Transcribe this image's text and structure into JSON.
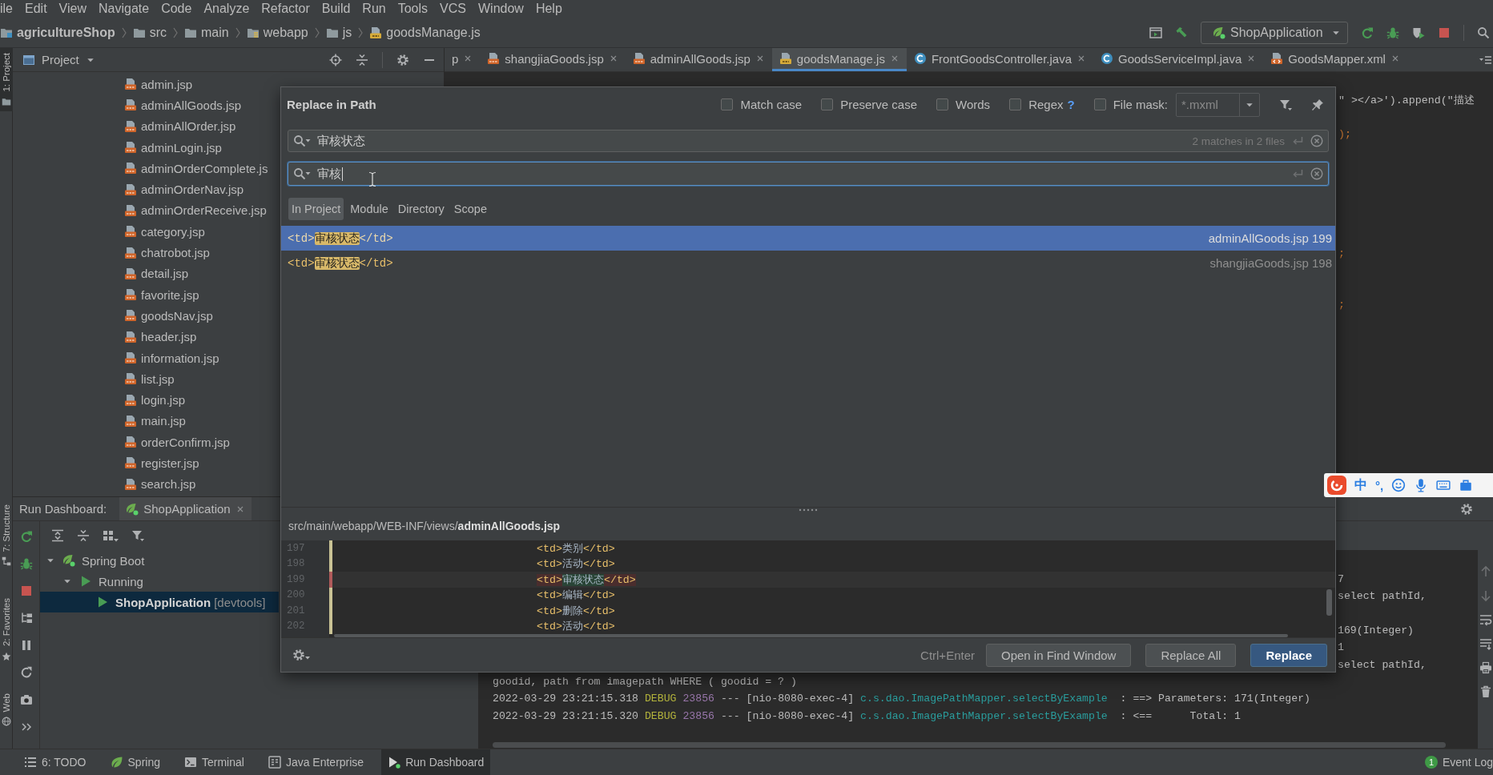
{
  "menu": [
    "ile",
    "Edit",
    "View",
    "Navigate",
    "Code",
    "Analyze",
    "Refactor",
    "Build",
    "Run",
    "Tools",
    "VCS",
    "Window",
    "Help"
  ],
  "navbar": {
    "breadcrumb": [
      {
        "label": "agricultureShop",
        "kind": "module"
      },
      {
        "label": "src",
        "kind": "folder"
      },
      {
        "label": "main",
        "kind": "folder"
      },
      {
        "label": "webapp",
        "kind": "web"
      },
      {
        "label": "js",
        "kind": "folder"
      },
      {
        "label": "goodsManage.js",
        "kind": "js"
      }
    ],
    "run_config": "ShopApplication"
  },
  "side_strip": [
    {
      "label": "1: Project",
      "kind": "project",
      "selected": true
    },
    {
      "label": "7: Structure",
      "kind": "structure",
      "selected": false
    },
    {
      "label": "2: Favorites",
      "kind": "favorites",
      "selected": false
    },
    {
      "label": "Web",
      "kind": "web",
      "selected": false
    }
  ],
  "project": {
    "title": "Project",
    "files": [
      "admin.jsp",
      "adminAllGoods.jsp",
      "adminAllOrder.jsp",
      "adminLogin.jsp",
      "adminOrderComplete.js",
      "adminOrderNav.jsp",
      "adminOrderReceive.jsp",
      "category.jsp",
      "chatrobot.jsp",
      "detail.jsp",
      "favorite.jsp",
      "goodsNav.jsp",
      "header.jsp",
      "information.jsp",
      "list.jsp",
      "login.jsp",
      "main.jsp",
      "orderConfirm.jsp",
      "register.jsp",
      "search.jsp"
    ]
  },
  "editor": {
    "tabs": [
      {
        "label": "p",
        "kind": "cut",
        "selected": false
      },
      {
        "label": "shangjiaGoods.jsp",
        "kind": "jsp",
        "selected": false
      },
      {
        "label": "adminAllGoods.jsp",
        "kind": "jsp",
        "selected": false
      },
      {
        "label": "goodsManage.js",
        "kind": "js",
        "selected": true
      },
      {
        "label": "FrontGoodsController.java",
        "kind": "class",
        "selected": false
      },
      {
        "label": "GoodsServiceImpl.java",
        "kind": "class",
        "selected": false
      },
      {
        "label": "GoodsMapper.xml",
        "kind": "xml",
        "selected": false
      }
    ],
    "lines": [
      {
        "kind": "plain",
        "text": "\" ></a>').append(\"描述"
      },
      {
        "kind": "blank"
      },
      {
        "kind": "keyword",
        "text": ");"
      },
      {
        "kind": "blank"
      },
      {
        "kind": "blank"
      },
      {
        "kind": "blank"
      },
      {
        "kind": "blank"
      },
      {
        "kind": "blank"
      },
      {
        "kind": "blank"
      },
      {
        "kind": "keyword",
        "text": ";"
      },
      {
        "kind": "blank"
      },
      {
        "kind": "blank"
      },
      {
        "kind": "keyword",
        "text": ";"
      }
    ]
  },
  "dialog": {
    "title": "Replace in Path",
    "options": [
      {
        "label": "Match case",
        "checked": false
      },
      {
        "label": "Preserve case",
        "checked": false
      },
      {
        "label": "Words",
        "checked": false
      },
      {
        "label": "Regex",
        "checked": false,
        "help": "?"
      },
      {
        "label": "File mask:",
        "checked": false
      }
    ],
    "file_mask": {
      "value": "*.mxml",
      "disabled": true
    },
    "search": {
      "value": "审核状态",
      "status": "2 matches in 2 files",
      "focused": false
    },
    "replace": {
      "value": "审核",
      "focused": true
    },
    "scopes": [
      {
        "label": "In Project",
        "selected": true
      },
      {
        "label": "Module",
        "selected": false
      },
      {
        "label": "Directory",
        "selected": false
      },
      {
        "label": "Scope",
        "selected": false
      }
    ],
    "results": [
      {
        "before": "<td>",
        "match": "审核状态",
        "after": "</td>",
        "location": "adminAllGoods.jsp 199",
        "selected": true
      },
      {
        "before": "<td>",
        "match": "审核状态",
        "after": "</td>",
        "location": "shangjiaGoods.jsp 198",
        "selected": false
      }
    ],
    "preview": {
      "path": "src/main/webapp/WEB-INF/views/**adminAllGoods.jsp**",
      "lines": [
        {
          "number": "197",
          "open": "<td>",
          "text": "类别",
          "close": "</td>",
          "current": false
        },
        {
          "number": "198",
          "open": "<td>",
          "text": "活动",
          "close": "</td>",
          "current": false
        },
        {
          "number": "199",
          "open": "<td>",
          "text": "审核状态",
          "close": "</td>",
          "current": true
        },
        {
          "number": "200",
          "open": "<td>",
          "text": "编辑",
          "close": "</td>",
          "current": false
        },
        {
          "number": "201",
          "open": "<td>",
          "text": "删除",
          "close": "</td>",
          "current": false
        },
        {
          "number": "202",
          "open": "<td>",
          "text": "活动",
          "close": "</td>",
          "current": false
        }
      ]
    },
    "shortcut": "Ctrl+Enter",
    "buttons": [
      {
        "label": "Open in Find Window",
        "primary": false
      },
      {
        "label": "Replace All",
        "primary": false
      },
      {
        "label": "Replace",
        "primary": true
      }
    ]
  },
  "run_dashboard": {
    "title": "Run Dashboard:",
    "tab": "ShopApplication",
    "tree": [
      {
        "label": "Spring Boot",
        "kind": "group",
        "expanded": true,
        "selected": false,
        "children": [
          {
            "label": "Running",
            "kind": "status",
            "expanded": true,
            "selected": false,
            "children": [
              {
                "label": "ShopApplication",
                "tag": "[devtools]",
                "kind": "app",
                "selected": true
              }
            ]
          }
        ]
      }
    ],
    "console": [
      {
        "kind": "tail",
        "segments": [
          {
            "text": "7",
            "kind": "plain"
          }
        ]
      },
      {
        "kind": "tail",
        "segments": [
          {
            "text": "select pathId,",
            "kind": "plain"
          }
        ]
      },
      {
        "kind": "blank"
      },
      {
        "kind": "tail",
        "segments": [
          {
            "text": "169(Integer)",
            "kind": "plain"
          }
        ]
      },
      {
        "kind": "tail",
        "segments": [
          {
            "text": "1",
            "kind": "plain"
          }
        ]
      },
      {
        "kind": "tail",
        "segments": [
          {
            "text": "select pathId,",
            "kind": "plain"
          }
        ]
      },
      {
        "kind": "full",
        "segments": [
          {
            "text": "goodid, path from imagepath WHERE ( goodid = ? )",
            "kind": "plain"
          }
        ]
      },
      {
        "kind": "full",
        "segments": [
          {
            "text": "2022-03-29 23:21:15.318",
            "kind": "plain"
          },
          {
            "text": "DEBUG",
            "kind": "level"
          },
          {
            "text": "23856",
            "kind": "pid"
          },
          {
            "text": "--- [nio-8080-exec-4]",
            "kind": "plain"
          },
          {
            "text": "c.s.dao.ImagePathMapper.selectByExample",
            "kind": "logger"
          },
          {
            "text": " : ==> Parameters: 171(Integer)",
            "kind": "plain"
          }
        ]
      },
      {
        "kind": "full",
        "segments": [
          {
            "text": "2022-03-29 23:21:15.320",
            "kind": "plain"
          },
          {
            "text": "DEBUG",
            "kind": "level"
          },
          {
            "text": "23856",
            "kind": "pid"
          },
          {
            "text": "--- [nio-8080-exec-4]",
            "kind": "plain"
          },
          {
            "text": "c.s.dao.ImagePathMapper.selectByExample",
            "kind": "logger"
          },
          {
            "text": " : <==      Total: 1",
            "kind": "plain"
          }
        ]
      }
    ]
  },
  "tool_windows": [
    {
      "label": "6: TODO",
      "kind": "todo",
      "selected": false
    },
    {
      "label": "Spring",
      "kind": "spring",
      "selected": false
    },
    {
      "label": "Terminal",
      "kind": "terminal",
      "selected": false
    },
    {
      "label": "Java Enterprise",
      "kind": "enterprise",
      "selected": false
    },
    {
      "label": "Run Dashboard",
      "kind": "run",
      "selected": true
    }
  ],
  "event_log": {
    "label": "Event Log",
    "count": "1"
  },
  "ime_toolbar": {
    "mode": "中",
    "punctuation": "°,"
  }
}
